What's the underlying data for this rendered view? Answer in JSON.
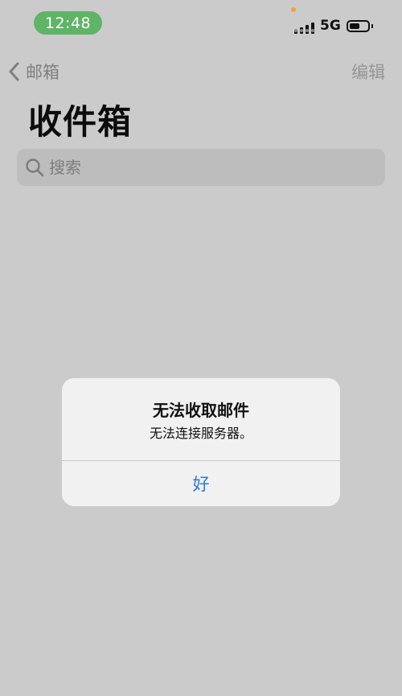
{
  "status_bar": {
    "time": "12:48",
    "network": "5G",
    "battery_level": 0.55,
    "mic_indicator_color": "#f0a234",
    "time_pill_color": "#5fb466",
    "signal_icon": "cellular-signal-icon",
    "battery_icon": "battery-icon"
  },
  "nav": {
    "back_label": "邮箱",
    "back_icon": "chevron-left-icon",
    "edit_label": "编辑"
  },
  "page": {
    "title": "收件箱"
  },
  "search": {
    "placeholder": "搜索",
    "icon": "search-icon"
  },
  "alert": {
    "title": "无法收取邮件",
    "message": "无法连接服务器。",
    "button_label": "好",
    "button_color": "#2f7bd8"
  }
}
